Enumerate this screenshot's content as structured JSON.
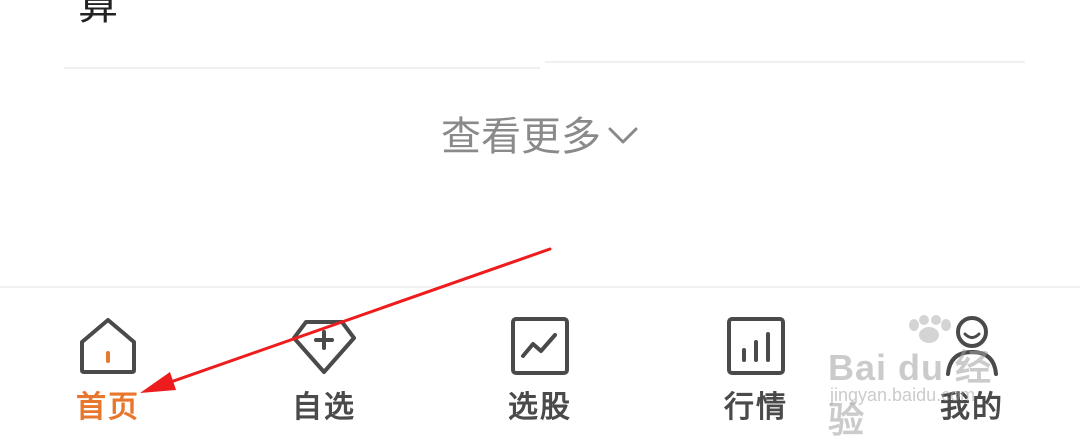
{
  "content": {
    "top_char": "算",
    "see_more_label": "查看更多"
  },
  "tabbar": {
    "tabs": [
      {
        "label": "首页",
        "icon": "home-icon",
        "active": true
      },
      {
        "label": "自选",
        "icon": "tag-plus-icon",
        "active": false
      },
      {
        "label": "选股",
        "icon": "stock-trend-icon",
        "active": false
      },
      {
        "label": "行情",
        "icon": "bar-chart-icon",
        "active": false
      },
      {
        "label": "我的",
        "icon": "user-icon",
        "active": false
      }
    ]
  },
  "watermark": {
    "main": "Bai du 经验",
    "sub": "jingyan.baidu.com"
  },
  "colors": {
    "accent": "#e8772e",
    "tab_default": "#4a4a4a",
    "annotation_arrow": "#ee1c1c"
  }
}
